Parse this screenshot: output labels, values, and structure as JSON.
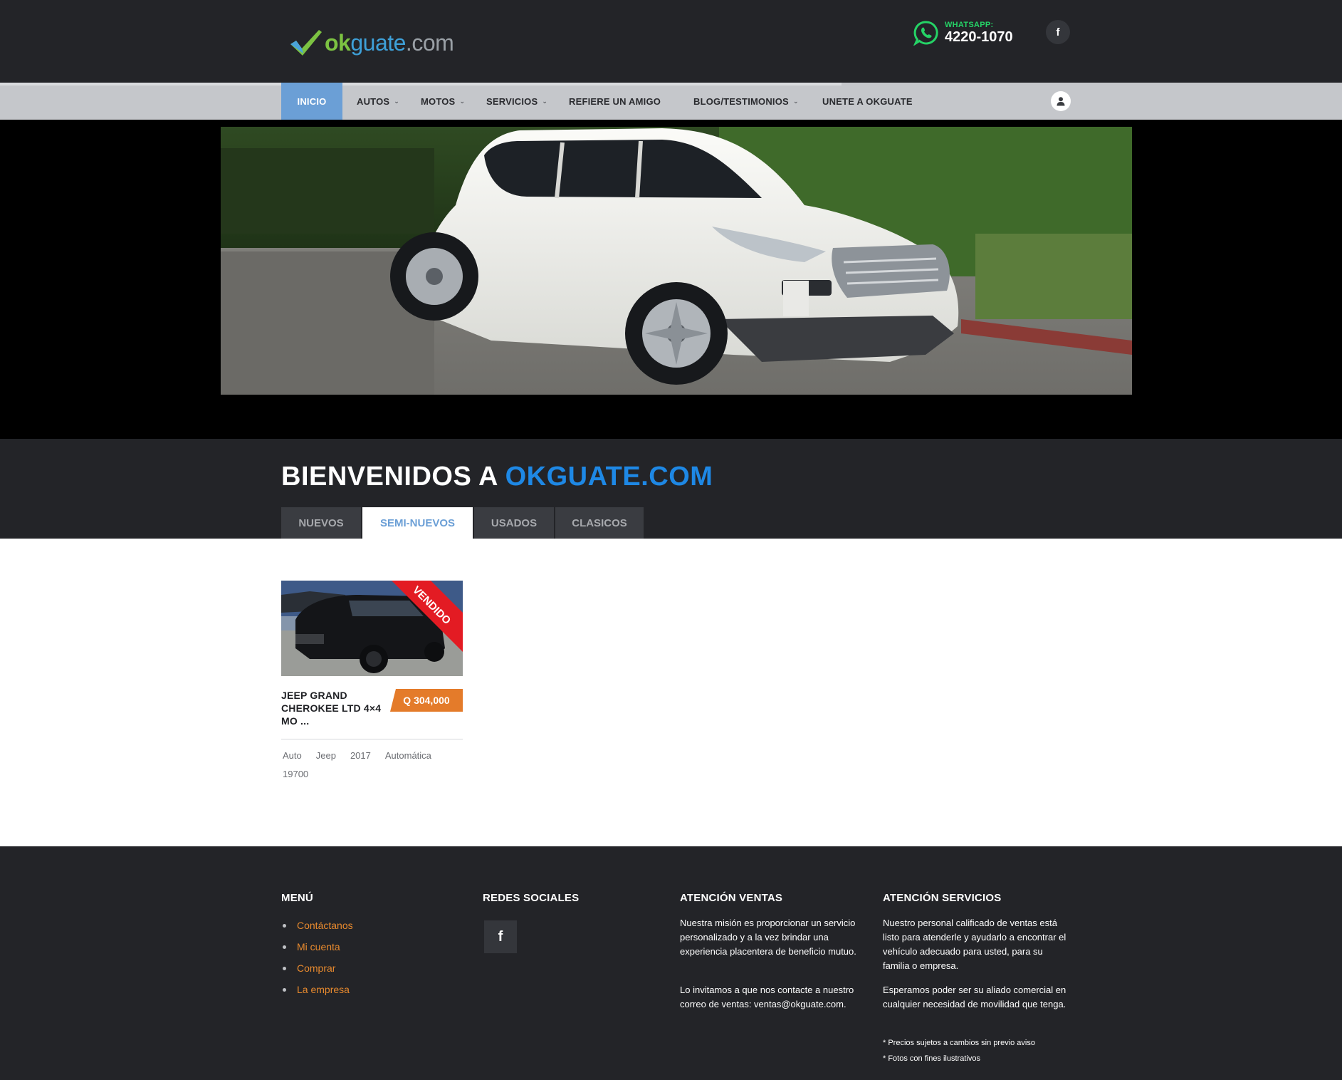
{
  "header": {
    "logo": {
      "ok": "ok",
      "guate": "guate",
      "dotcom": ".com"
    },
    "whatsapp": {
      "label": "WHATSAPP:",
      "number": "4220-1070"
    },
    "facebook_icon": "f"
  },
  "nav": {
    "items": [
      {
        "label": "INICIO",
        "active": true,
        "dropdown": false
      },
      {
        "label": "AUTOS",
        "dropdown": true
      },
      {
        "label": "MOTOS",
        "dropdown": true
      },
      {
        "label": "SERVICIOS",
        "dropdown": true
      },
      {
        "label": "REFIERE UN AMIGO",
        "dropdown": false
      },
      {
        "label": "BLOG/TESTIMONIOS",
        "dropdown": true
      },
      {
        "label": "UNETE A OKGUATE",
        "dropdown": false
      }
    ],
    "chevron": "⌄"
  },
  "welcome": {
    "title_prefix": "BIENVENIDOS A ",
    "title_accent": "OKGUATE.COM",
    "tabs": [
      "NUEVOS",
      "SEMI-NUEVOS",
      "USADOS",
      "CLASICOS"
    ],
    "active_tab": "SEMI-NUEVOS"
  },
  "listing": {
    "ribbon": "VENDIDO",
    "title": "JEEP GRAND CHEROKEE LTD 4×4 MO ...",
    "price": "Q 304,000",
    "meta": [
      "Auto",
      "Jeep",
      "2017",
      "Automática",
      "19700"
    ]
  },
  "footer": {
    "menu_heading": "MENÚ",
    "menu_items": [
      "Contáctanos",
      "Mi cuenta",
      "Comprar",
      "La empresa"
    ],
    "social_heading": "REDES SOCIALES",
    "social_icon": "f",
    "ventas_heading": "ATENCIÓN VENTAS",
    "ventas_p1": "Nuestra misión es proporcionar un servicio personalizado y a la vez brindar una experiencia placentera de beneficio mutuo.",
    "ventas_p2": "Lo invitamos a que nos contacte a nuestro correo de ventas: ventas@okguate.com.",
    "servicios_heading": "ATENCIÓN SERVICIOS",
    "servicios_p1": "Nuestro personal calificado de ventas está listo para atenderle y ayudarlo a encontrar el vehículo adecuado para usted, para su familia o empresa.",
    "servicios_p2": "Esperamos poder ser su aliado comercial en cualquier necesidad de movilidad que tenga.",
    "note1": "* Precios sujetos a cambios sin previo aviso",
    "note2": "* Fotos con fines ilustrativos"
  },
  "colors": {
    "header_bg": "#232428",
    "nav_bg": "#c5c7cb",
    "nav_active": "#6b9fd6",
    "accent_blue": "#1e88e5",
    "price_orange": "#e47b2a",
    "ribbon_red": "#e31b23",
    "link_orange": "#e88a2e",
    "whatsapp_green": "#25d366"
  }
}
